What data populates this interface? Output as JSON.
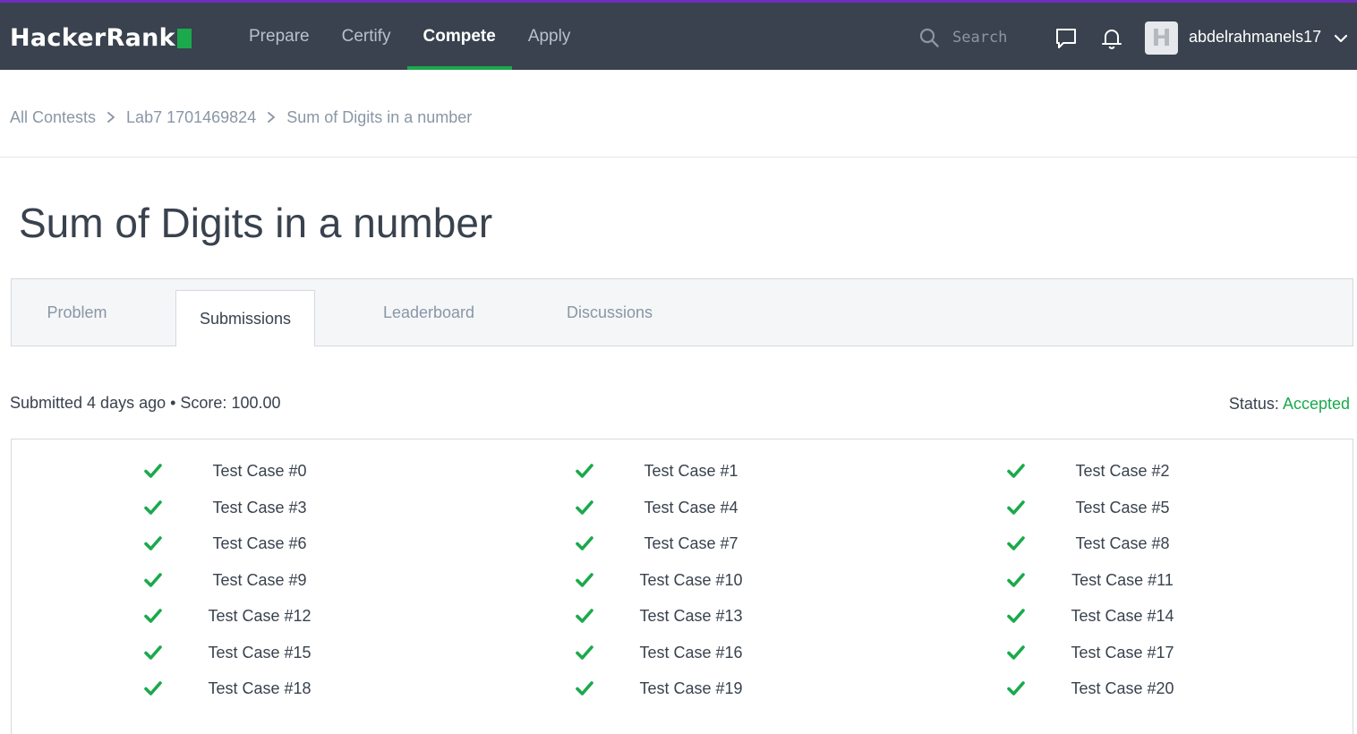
{
  "brand": {
    "name": "HackerRank"
  },
  "nav": {
    "items": [
      {
        "label": "Prepare",
        "active": false
      },
      {
        "label": "Certify",
        "active": false
      },
      {
        "label": "Compete",
        "active": true
      },
      {
        "label": "Apply",
        "active": false
      }
    ],
    "search_placeholder": "Search",
    "username": "abdelrahmanels17",
    "avatar_letter": "H"
  },
  "breadcrumb": [
    "All Contests",
    "Lab7 1701469824",
    "Sum of Digits in a number"
  ],
  "page_title": "Sum of Digits in a number",
  "tabs": [
    {
      "label": "Problem",
      "active": false
    },
    {
      "label": "Submissions",
      "active": true
    },
    {
      "label": "Leaderboard",
      "active": false
    },
    {
      "label": "Discussions",
      "active": false
    }
  ],
  "submission": {
    "info": "Submitted 4 days ago • Score: 100.00",
    "status_label": "Status:",
    "status_value": "Accepted"
  },
  "test_cases": [
    "Test Case #0",
    "Test Case #1",
    "Test Case #2",
    "Test Case #3",
    "Test Case #4",
    "Test Case #5",
    "Test Case #6",
    "Test Case #7",
    "Test Case #8",
    "Test Case #9",
    "Test Case #10",
    "Test Case #11",
    "Test Case #12",
    "Test Case #13",
    "Test Case #14",
    "Test Case #15",
    "Test Case #16",
    "Test Case #17",
    "Test Case #18",
    "Test Case #19",
    "Test Case #20"
  ],
  "colors": {
    "accent": "#1ba94c",
    "topbar": "#39424e",
    "topbar_border": "#6f2dbd"
  }
}
